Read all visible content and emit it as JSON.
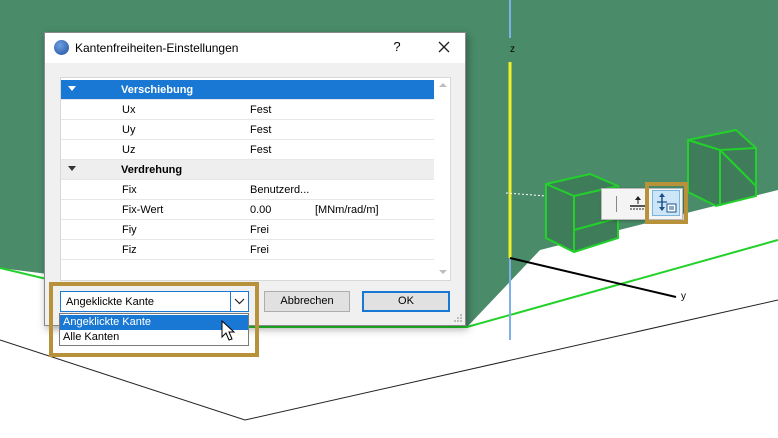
{
  "viewport": {
    "axis_z_label": "z",
    "axis_y_label": "y",
    "colors": {
      "ground": "#4a8c6a",
      "edge": "#22d12a",
      "highlight": "#b8923a"
    }
  },
  "tool_palette": {
    "tools": [
      "offset-edge-icon",
      "edge-release-settings-icon"
    ]
  },
  "dialog": {
    "title": "Kantenfreiheiten-Einstellungen",
    "help_label": "?",
    "groups": [
      {
        "label": "Verschiebung",
        "rows": [
          {
            "name": "Ux",
            "value": "Fest",
            "unit": ""
          },
          {
            "name": "Uy",
            "value": "Fest",
            "unit": ""
          },
          {
            "name": "Uz",
            "value": "Fest",
            "unit": ""
          }
        ]
      },
      {
        "label": "Verdrehung",
        "rows": [
          {
            "name": "Fix",
            "value": "Benutzerd...",
            "unit": ""
          },
          {
            "name": "Fix-Wert",
            "value": "0.00",
            "unit": "[MNm/rad/m]"
          },
          {
            "name": "Fiy",
            "value": "Frei",
            "unit": ""
          },
          {
            "name": "Fiz",
            "value": "Frei",
            "unit": ""
          }
        ]
      }
    ],
    "scope_select": {
      "selected": "Angeklickte Kante",
      "options": [
        "Angeklickte Kante",
        "Alle Kanten"
      ]
    },
    "cancel_label": "Abbrechen",
    "ok_label": "OK"
  }
}
